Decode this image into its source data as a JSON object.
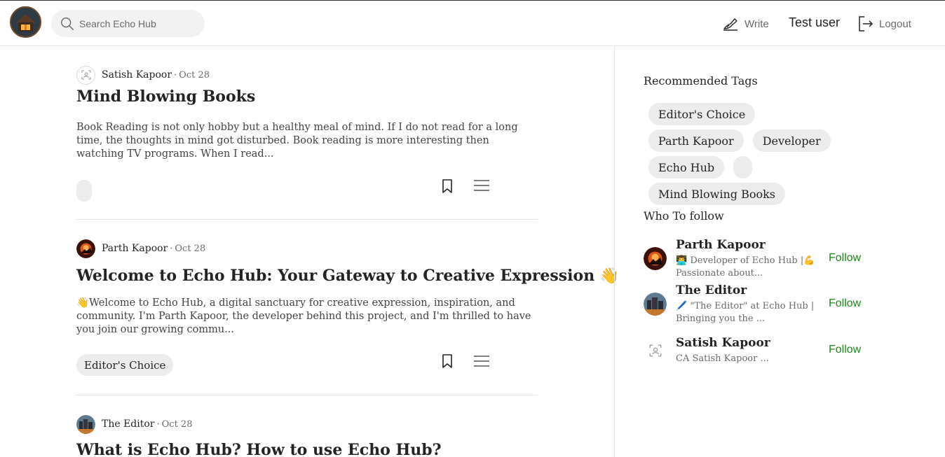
{
  "header": {
    "search_placeholder": "Search Echo Hub",
    "write_label": "Write",
    "username": "Test user",
    "logout_label": "Logout"
  },
  "posts": [
    {
      "author": "Satish Kapoor",
      "dot": "·",
      "date": "Oct 28",
      "title": "Mind Blowing Books",
      "excerpt": "Book Reading is not only hobby but a healthy meal of mind. If I do not read for a long time, the thoughts in mind got disturbed. Book reading is more interesting then watching TV programs. When I read...",
      "tag": ""
    },
    {
      "author": "Parth Kapoor",
      "dot": "·",
      "date": "Oct 28",
      "title": "Welcome to Echo Hub: Your Gateway to Creative Expression 👋",
      "excerpt": "👋Welcome to Echo Hub, a digital sanctuary for creative expression, inspiration, and community. I'm Parth Kapoor, the developer behind this project, and I'm thrilled to have you join our growing commu...",
      "tag": "Editor's Choice"
    },
    {
      "author": "The Editor",
      "dot": "·",
      "date": "Oct 28",
      "title": "What is Echo Hub? How to use Echo Hub?"
    }
  ],
  "sidebar": {
    "tags_title": "Recommended Tags",
    "tags": [
      "Editor's Choice",
      "Parth Kapoor",
      "Developer",
      "Echo Hub",
      "",
      "Mind Blowing Books"
    ],
    "follow_title": "Who To follow",
    "follow": [
      {
        "name": "Parth Kapoor",
        "bio": "👨‍💻 Developer of Echo Hub |💪 Passionate about...",
        "button": "Follow"
      },
      {
        "name": "The Editor",
        "bio": "🖊️ \"The Editor\" at Echo Hub | Bringing you the ...",
        "button": "Follow"
      },
      {
        "name": "Satish Kapoor",
        "bio": "CA Satish Kapoor ...",
        "button": "Follow"
      }
    ]
  }
}
